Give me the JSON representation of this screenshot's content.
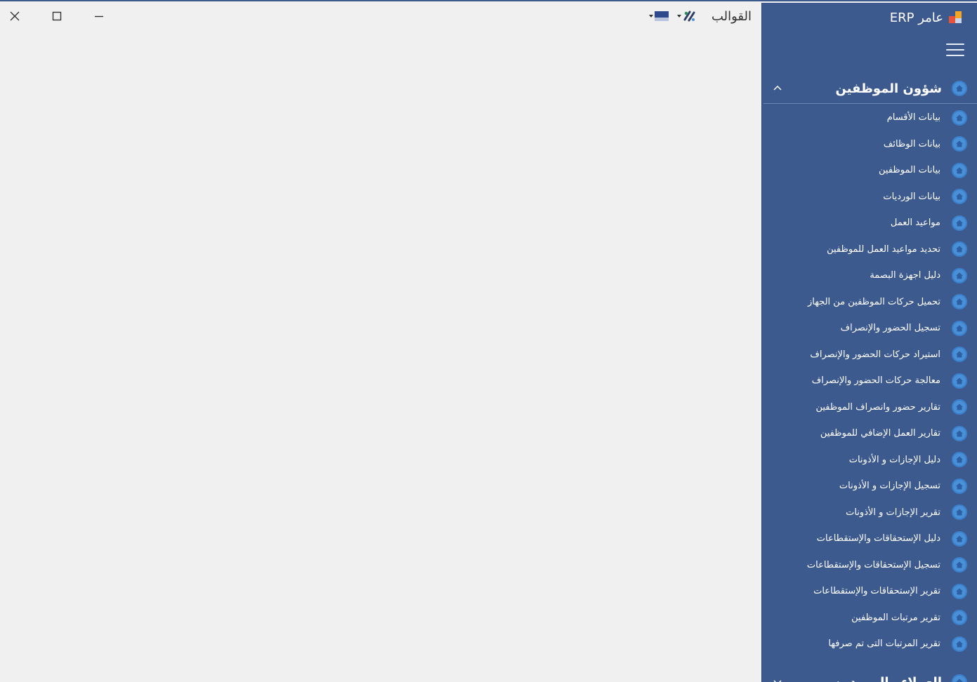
{
  "titlebar": {
    "templates_label": "القوالب"
  },
  "brand": {
    "title": "عامر ERP"
  },
  "sidebar": {
    "section_title": "شؤون الموظفين",
    "items": [
      {
        "label": "بيانات الأقسام"
      },
      {
        "label": "بيانات الوظائف"
      },
      {
        "label": "بيانات الموظفين"
      },
      {
        "label": "بيانات الورديات"
      },
      {
        "label": "مواعيد العمل"
      },
      {
        "label": "تحديد مواعيد العمل للموظفين"
      },
      {
        "label": "دليل اجهزة البصمة"
      },
      {
        "label": "تحميل حركات الموظفين من الجهاز"
      },
      {
        "label": "تسجيل الحضور والإنصراف"
      },
      {
        "label": "استيراد حركات الحضور والإنصراف"
      },
      {
        "label": "معالجة حركات الحضور والإنصراف"
      },
      {
        "label": "تقارير حضور وانصراف الموظفين"
      },
      {
        "label": "تقارير العمل الإضافي للموظفين"
      },
      {
        "label": "دليل الإجازات و الأذونات"
      },
      {
        "label": "تسجيل الإجازات و الأذونات"
      },
      {
        "label": "تقرير الإجازات و الأذونات"
      },
      {
        "label": "دليل الإستحقاقات والإستقطاعات"
      },
      {
        "label": "تسجيل الإستحقاقات والإستقطاعات"
      },
      {
        "label": "تقرير الإستحقاقات والإستقطاعات"
      },
      {
        "label": "تقرير مرتبات الموظفين"
      },
      {
        "label": "تقرير المرتبات التى تم صرفها"
      }
    ],
    "next_section_title": "العملاء والموردين"
  },
  "colors": {
    "sidebar_bg": "#3d5a8f",
    "icon_bg": "#4a90d9",
    "content_bg": "#f0f0f0"
  }
}
